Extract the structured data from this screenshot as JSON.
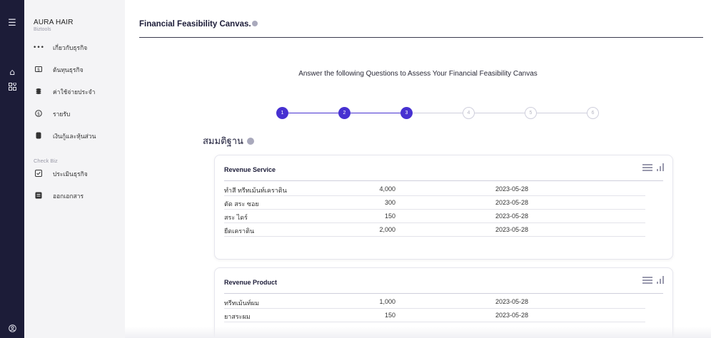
{
  "rail": {
    "icons": [
      "hamburger-menu-icon",
      "home-icon",
      "apps-icon",
      "user-icon"
    ]
  },
  "sidebar": {
    "brand": "AURA HAIR",
    "brand_sub": "Biztools",
    "items": [
      {
        "icon": "dots-icon",
        "label": "เกี่ยวกับธุรกิจ"
      },
      {
        "icon": "cost-icon",
        "label": "ต้นทุนธุรกิจ"
      },
      {
        "icon": "coins-icon",
        "label": "ค่าใช้จ่ายประจำ"
      },
      {
        "icon": "income-icon",
        "label": "รายรับ"
      },
      {
        "icon": "loan-icon",
        "label": "เงินกู้และหุ้นส่วน"
      }
    ],
    "section2_label": "Check Biz",
    "items2": [
      {
        "icon": "checkbox-icon",
        "label": "ประเมินธุรกิจ"
      },
      {
        "icon": "document-icon",
        "label": "ออกเอกสาร"
      }
    ]
  },
  "main": {
    "title": "Financial Feasibility Canvas.",
    "question": "Answer the following Questions to Assess Your Financial Feasibility Canvas",
    "steps": [
      {
        "label": "1",
        "done": true
      },
      {
        "label": "2",
        "done": true
      },
      {
        "label": "3",
        "done": true
      },
      {
        "label": "4",
        "done": false
      },
      {
        "label": "5",
        "done": false
      },
      {
        "label": "6",
        "done": false
      }
    ],
    "section_title": "สมมติฐาน",
    "colors": {
      "accent": "#4731d1",
      "rail": "#1c1c38"
    }
  },
  "cards": [
    {
      "title": "Revenue Service",
      "rows": [
        {
          "name": "ทำสี ทรีทเม้นท์เคราติน",
          "amount": "4,000",
          "date": "2023-05-28"
        },
        {
          "name": "ตัด สระ ซอย",
          "amount": "300",
          "date": "2023-05-28"
        },
        {
          "name": "สระ ไดร์",
          "amount": "150",
          "date": "2023-05-28"
        },
        {
          "name": "ยืดเคราติน",
          "amount": "2,000",
          "date": "2023-05-28"
        }
      ]
    },
    {
      "title": "Revenue Product",
      "rows": [
        {
          "name": "ทรีทเม้นท์ผม",
          "amount": "1,000",
          "date": "2023-05-28"
        },
        {
          "name": "ยาสระผม",
          "amount": "150",
          "date": "2023-05-28"
        }
      ]
    }
  ]
}
